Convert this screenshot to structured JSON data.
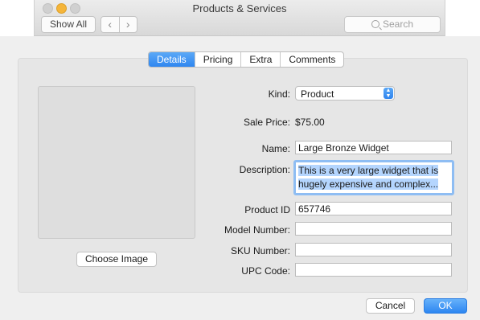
{
  "window": {
    "title": "Products & Services"
  },
  "toolbar": {
    "show_all_label": "Show All",
    "back_glyph": "‹",
    "forward_glyph": "›",
    "search_placeholder": "Search",
    "search_icon": "search-icon"
  },
  "tabs": [
    {
      "label": "Details",
      "active": true
    },
    {
      "label": "Pricing",
      "active": false
    },
    {
      "label": "Extra",
      "active": false
    },
    {
      "label": "Comments",
      "active": false
    }
  ],
  "image": {
    "choose_label": "Choose Image"
  },
  "form": {
    "kind": {
      "label": "Kind:",
      "value": "Product"
    },
    "sale_price": {
      "label": "Sale Price:",
      "value": "$75.00"
    },
    "name": {
      "label": "Name:",
      "value": "Large Bronze Widget"
    },
    "description": {
      "label": "Description:",
      "value": "This is a very large widget that is hugely expensive and complex..."
    },
    "product_id": {
      "label": "Product ID",
      "value": "657746"
    },
    "model_number": {
      "label": "Model Number:",
      "value": ""
    },
    "sku_number": {
      "label": "SKU Number:",
      "value": ""
    },
    "upc_code": {
      "label": "UPC Code:",
      "value": ""
    }
  },
  "buttons": {
    "cancel": "Cancel",
    "ok": "OK"
  },
  "colors": {
    "accent": "#2f86f0",
    "selection": "#b4d5fe",
    "focus_ring": "#8ebdf3"
  }
}
